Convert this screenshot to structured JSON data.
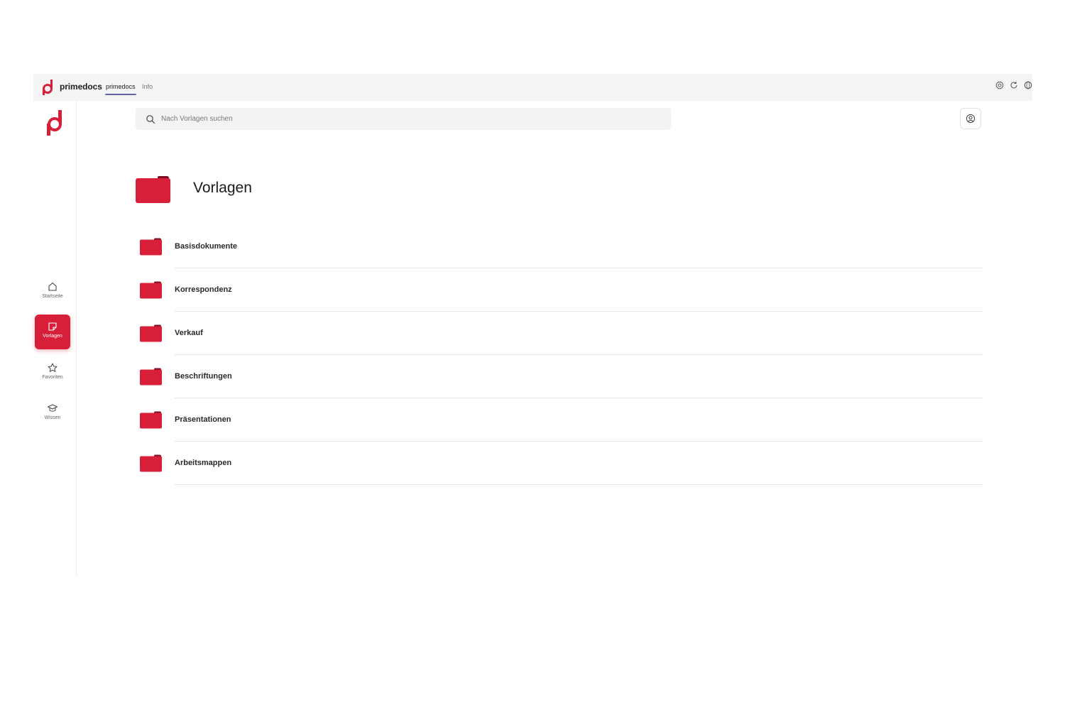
{
  "topbar": {
    "brand_name": "primedocs",
    "tabs": [
      {
        "label": "primedocs",
        "active": true
      },
      {
        "label": "Info",
        "active": false
      }
    ],
    "actions": [
      "info-circle-icon",
      "refresh-icon",
      "globe-icon"
    ]
  },
  "sidebar": {
    "items": [
      {
        "label": "Startseite",
        "icon": "home-icon",
        "active": false
      },
      {
        "label": "Vorlagen",
        "icon": "template-icon",
        "active": true
      },
      {
        "label": "Favoriten",
        "icon": "star-icon",
        "active": false
      },
      {
        "label": "Wissen",
        "icon": "graduation-cap-icon",
        "active": false
      }
    ]
  },
  "search": {
    "placeholder": "Nach Vorlagen suchen",
    "value": ""
  },
  "page": {
    "title": "Vorlagen"
  },
  "folders": [
    {
      "label": "Basisdokumente"
    },
    {
      "label": "Korrespondenz"
    },
    {
      "label": "Verkauf"
    },
    {
      "label": "Beschriftungen"
    },
    {
      "label": "Präsentationen"
    },
    {
      "label": "Arbeitsmappen"
    }
  ],
  "colors": {
    "accent": "#d71f3a",
    "tab_underline": "#6264a7",
    "topbar_bg": "#f4f4f5"
  }
}
